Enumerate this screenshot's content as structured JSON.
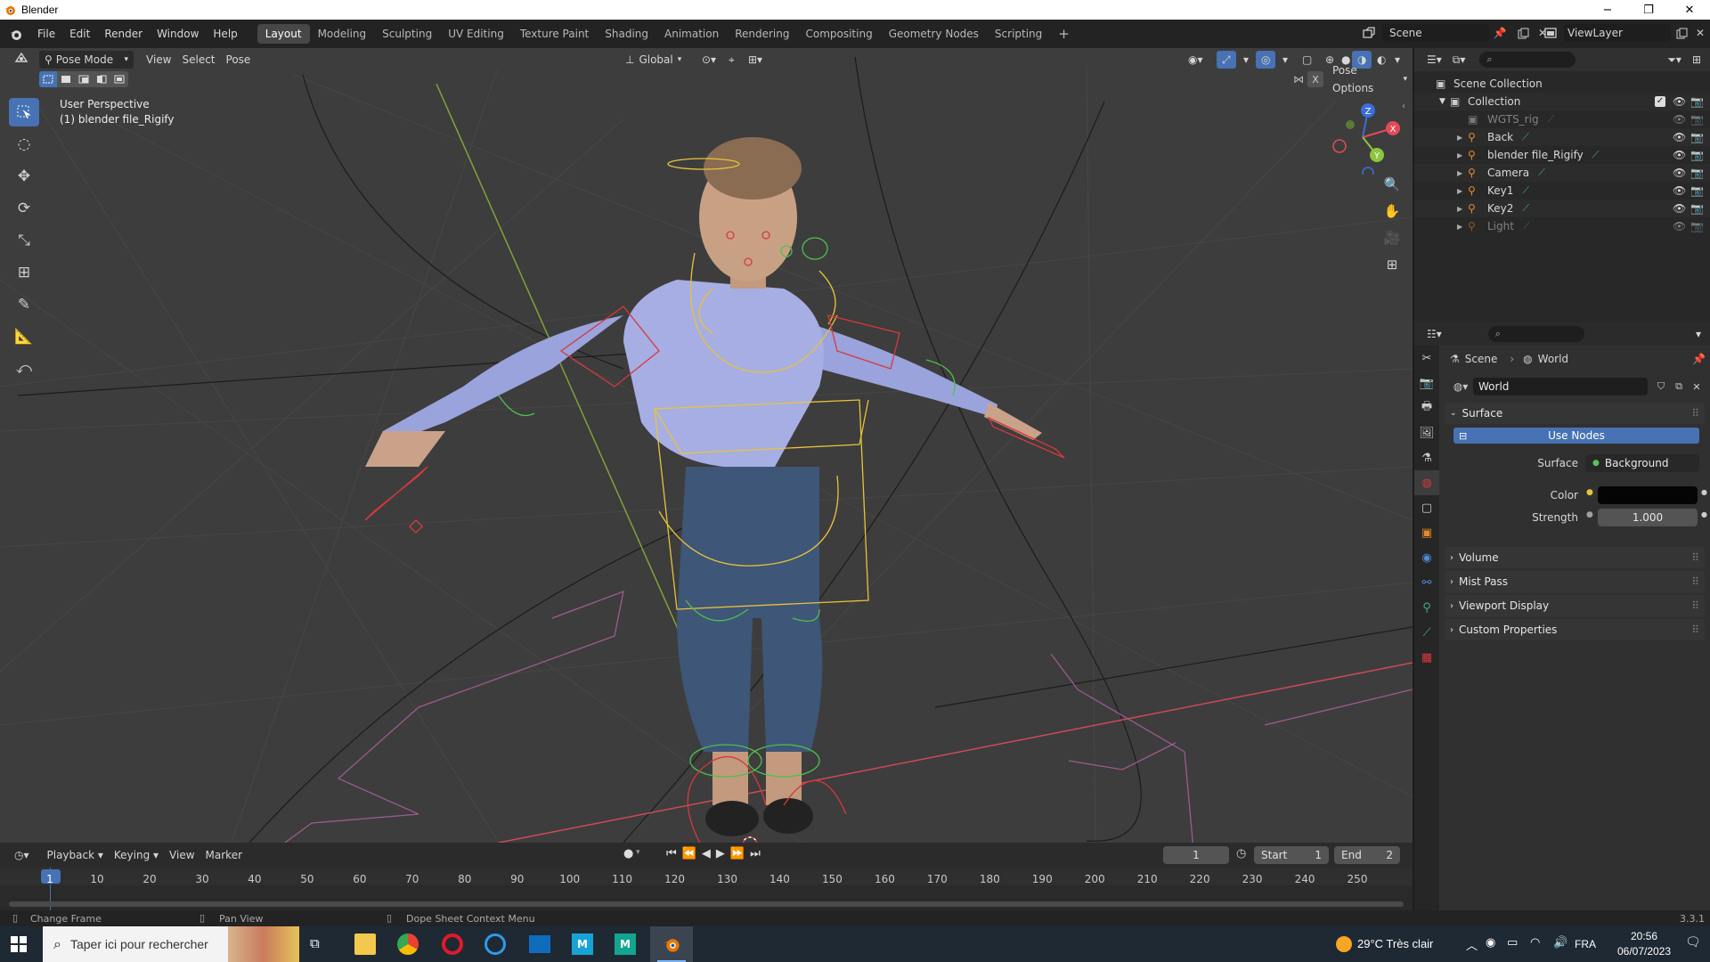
{
  "window": {
    "title": "Blender",
    "logo_icon": "blender-logo-icon",
    "minimize": "−",
    "maximize": "❐",
    "close": "✕"
  },
  "menu": {
    "items": [
      "File",
      "Edit",
      "Render",
      "Window",
      "Help"
    ],
    "workspaces": [
      "Layout",
      "Modeling",
      "Sculpting",
      "UV Editing",
      "Texture Paint",
      "Shading",
      "Animation",
      "Rendering",
      "Compositing",
      "Geometry Nodes",
      "Scripting"
    ],
    "active_workspace": "Layout",
    "add_workspace": "+",
    "scene_label": "Scene",
    "viewlayer_label": "ViewLayer"
  },
  "viewport": {
    "mode": "Pose Mode",
    "menus": [
      "View",
      "Select",
      "Pose"
    ],
    "orientation": "Global",
    "pose_options": "Pose Options",
    "perspective_label": "User Perspective",
    "object_label": "(1) blender file_Rigify",
    "gizmo_axes": [
      "Z",
      "X",
      "Y"
    ],
    "grid_color": "#474747"
  },
  "timeline": {
    "menus": [
      "Playback",
      "Keying",
      "View",
      "Marker"
    ],
    "current_frame": "1",
    "start_label": "Start",
    "start_value": "1",
    "end_label": "End",
    "end_value": "2",
    "ruler": [
      "1",
      "10",
      "20",
      "30",
      "40",
      "50",
      "60",
      "70",
      "80",
      "90",
      "100",
      "110",
      "120",
      "130",
      "140",
      "150",
      "160",
      "170",
      "180",
      "190",
      "200",
      "210",
      "220",
      "230",
      "240",
      "250"
    ]
  },
  "statusbar": {
    "change_frame": "Change Frame",
    "pan_view": "Pan View",
    "context_menu": "Dope Sheet Context Menu",
    "version": "3.3.1"
  },
  "outliner": {
    "scene_collection": "Scene Collection",
    "collection": "Collection",
    "items": [
      {
        "name": "WGTS_rig",
        "dim": true
      },
      {
        "name": "Back",
        "dim": false
      },
      {
        "name": "blender file_Rigify",
        "dim": false
      },
      {
        "name": "Camera",
        "dim": false
      },
      {
        "name": "Key1",
        "dim": false
      },
      {
        "name": "Key2",
        "dim": false
      },
      {
        "name": "Light",
        "dim": true
      }
    ]
  },
  "properties": {
    "breadcrumb_scene": "Scene",
    "breadcrumb_world": "World",
    "world_name": "World",
    "surface_panel": "Surface",
    "use_nodes": "Use Nodes",
    "surface_label": "Surface",
    "surface_value": "Background",
    "color_label": "Color",
    "strength_label": "Strength",
    "strength_value": "1.000",
    "collapsed_panels": [
      "Volume",
      "Mist Pass",
      "Viewport Display",
      "Custom Properties"
    ]
  },
  "taskbar": {
    "search_placeholder": "Taper ici pour rechercher",
    "weather": "29°C  Très clair",
    "language": "FRA",
    "time": "20:56",
    "date": "06/07/2023"
  },
  "colors": {
    "accent": "#4772b3",
    "active_frame": "#4772b3",
    "rig_yellow": "#e8c33b",
    "rig_green": "#4fbf4f",
    "rig_red": "#d8383d",
    "x_axis_red": "#cf4a55",
    "y_axis_green": "#7fa33a"
  }
}
